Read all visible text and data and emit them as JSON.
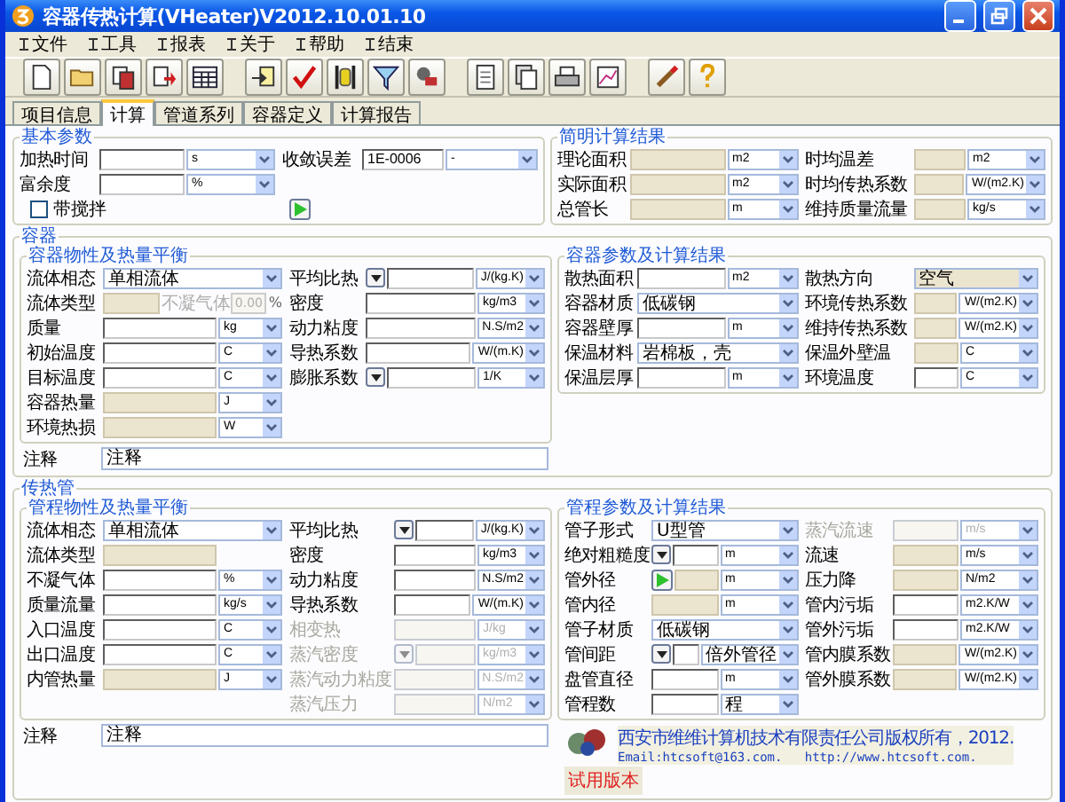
{
  "window": {
    "title": "容器传热计算(VHeater)V2012.10.01.10"
  },
  "menu": [
    "文件",
    "工具",
    "报表",
    "关于",
    "帮助",
    "结束"
  ],
  "tabs": [
    {
      "label": "项目信息",
      "selected": false
    },
    {
      "label": "计算",
      "selected": true
    },
    {
      "label": "管道系列",
      "selected": false
    },
    {
      "label": "容器定义",
      "selected": false
    },
    {
      "label": "计算报告",
      "selected": false
    }
  ],
  "basic": {
    "title": "基本参数",
    "left": [
      {
        "label": "加热时间",
        "kind": "input",
        "unit": "s"
      },
      {
        "label": "富余度",
        "kind": "input",
        "unit": "%"
      }
    ],
    "middle": [
      {
        "label": "收敛误差",
        "kind": "input",
        "value": "1E-0006",
        "unit": "-"
      }
    ],
    "checkbox": {
      "label": "带搅拌",
      "checked": false
    }
  },
  "summary": {
    "title": "简明计算结果",
    "left": [
      {
        "label": "理论面积",
        "kind": "readonly",
        "unit": "m2"
      },
      {
        "label": "实际面积",
        "kind": "readonly",
        "unit": "m2"
      },
      {
        "label": "总管长",
        "kind": "readonly",
        "unit": "m"
      }
    ],
    "right": [
      {
        "label": "时均温差",
        "kind": "readonly",
        "unit": "m2"
      },
      {
        "label": "时均传热系数",
        "kind": "readonly",
        "unit": "W/(m2.K)"
      },
      {
        "label": "维持质量流量",
        "kind": "readonly",
        "unit": "kg/s"
      }
    ]
  },
  "vessel": {
    "title": "容器",
    "balance": {
      "title": "容器物性及热量平衡",
      "left": [
        {
          "label": "流体相态",
          "kind": "combo",
          "value": "单相流体"
        },
        {
          "label": "流体类型",
          "kind": "gas",
          "text": "不凝气体",
          "amount": "0.00",
          "unit": "%"
        },
        {
          "label": "质量",
          "kind": "input",
          "unit": "kg"
        },
        {
          "label": "初始温度",
          "kind": "input",
          "unit": "C"
        },
        {
          "label": "目标温度",
          "kind": "input",
          "unit": "C"
        },
        {
          "label": "容器热量",
          "kind": "readonly",
          "unit": "J"
        },
        {
          "label": "环境热损",
          "kind": "readonly",
          "unit": "W"
        }
      ],
      "right": [
        {
          "label": "平均比热",
          "kind": "input",
          "button": {
            "kind": "menu"
          },
          "unit": "J/(kg.K)"
        },
        {
          "label": "密度",
          "kind": "input",
          "unit": "kg/m3"
        },
        {
          "label": "动力粘度",
          "kind": "input",
          "unit": "N.S/m2"
        },
        {
          "label": "导热系数",
          "kind": "input",
          "unit": "W/(m.K)"
        },
        {
          "label": "膨胀系数",
          "kind": "input",
          "button": {
            "kind": "menu"
          },
          "unit": "1/K"
        }
      ]
    },
    "note": {
      "label": "注释",
      "value": "注释"
    },
    "params": {
      "title": "容器参数及计算结果",
      "left": [
        {
          "label": "散热面积",
          "kind": "input",
          "unit": "m2"
        },
        {
          "label": "容器材质",
          "kind": "combo",
          "value": "低碳钢"
        },
        {
          "label": "容器壁厚",
          "kind": "input",
          "unit": "m"
        },
        {
          "label": "保温材料",
          "kind": "combo",
          "value": "岩棉板，壳"
        },
        {
          "label": "保温层厚",
          "kind": "input",
          "unit": "m"
        }
      ],
      "right": [
        {
          "label": "散热方向",
          "kind": "combo-readonly",
          "value": "空气"
        },
        {
          "label": "环境传热系数",
          "kind": "readonly",
          "unit": "W/(m2.K)"
        },
        {
          "label": "维持传热系数",
          "kind": "readonly",
          "unit": "W/(m2.K)"
        },
        {
          "label": "保温外壁温",
          "kind": "readonly",
          "unit": "C"
        },
        {
          "label": "环境温度",
          "kind": "input",
          "unit": "C"
        }
      ]
    }
  },
  "tube": {
    "title": "传热管",
    "balance": {
      "title": "管程物性及热量平衡",
      "left": [
        {
          "label": "流体相态",
          "kind": "combo",
          "value": "单相流体"
        },
        {
          "label": "流体类型",
          "kind": "readonly"
        },
        {
          "label": "不凝气体",
          "kind": "input",
          "unit": "%"
        },
        {
          "label": "质量流量",
          "kind": "input",
          "unit": "kg/s"
        },
        {
          "label": "入口温度",
          "kind": "input",
          "unit": "C"
        },
        {
          "label": "出口温度",
          "kind": "input",
          "unit": "C"
        },
        {
          "label": "内管热量",
          "kind": "readonly",
          "unit": "J"
        }
      ],
      "right": [
        {
          "label": "平均比热",
          "kind": "input",
          "button": {
            "kind": "menu"
          },
          "unit": "J/(kg.K)"
        },
        {
          "label": "密度",
          "kind": "input",
          "unit": "kg/m3"
        },
        {
          "label": "动力粘度",
          "kind": "input",
          "unit": "N.S/m2"
        },
        {
          "label": "导热系数",
          "kind": "input",
          "unit": "W/(m.K)"
        },
        {
          "label": "相变热",
          "kind": "disabled",
          "unit": "J/kg"
        },
        {
          "label": "蒸汽密度",
          "kind": "disabled",
          "button": {
            "kind": "menu"
          },
          "unit": "kg/m3"
        },
        {
          "label": "蒸汽动力粘度",
          "kind": "disabled",
          "unit": "N.S/m2"
        },
        {
          "label": "蒸汽压力",
          "kind": "disabled",
          "unit": "N/m2"
        }
      ]
    },
    "note": {
      "label": "注释",
      "value": "注释"
    },
    "params": {
      "title": "管程参数及计算结果",
      "left": [
        {
          "label": "管子形式",
          "kind": "combo",
          "value": "U型管"
        },
        {
          "label": "绝对粗糙度",
          "kind": "input",
          "button": {
            "kind": "menu"
          },
          "unit": "m"
        },
        {
          "label": "管外径",
          "kind": "readonly",
          "button": {
            "kind": "play"
          },
          "unit": "m"
        },
        {
          "label": "管内径",
          "kind": "readonly",
          "unit": "m"
        },
        {
          "label": "管子材质",
          "kind": "combo",
          "value": "低碳钢"
        },
        {
          "label": "管间距",
          "kind": "input",
          "button": {
            "kind": "menu"
          },
          "unit": "倍外管径"
        },
        {
          "label": "盘管直径",
          "kind": "input",
          "unit": "m"
        },
        {
          "label": "管程数",
          "kind": "input",
          "unit": "程"
        }
      ],
      "right": [
        {
          "label": "蒸汽流速",
          "kind": "disabled",
          "unit": "m/s"
        },
        {
          "label": "流速",
          "kind": "readonly",
          "unit": "m/s"
        },
        {
          "label": "压力降",
          "kind": "readonly",
          "unit": "N/m2"
        },
        {
          "label": "管内污垢",
          "kind": "input",
          "unit": "m2.K/W"
        },
        {
          "label": "管外污垢",
          "kind": "input",
          "unit": "m2.K/W"
        },
        {
          "label": "管内膜系数",
          "kind": "readonly",
          "unit": "W/(m2.K)"
        },
        {
          "label": "管外膜系数",
          "kind": "readonly",
          "unit": "W/(m2.K)"
        }
      ]
    }
  },
  "copyright": {
    "company": "西安市维维计算机技术有限责任公司版权所有，2012.",
    "contact": "Email:htcsoft@163.com.   http://www.htcsoft.com.",
    "trial": "试用版本"
  }
}
